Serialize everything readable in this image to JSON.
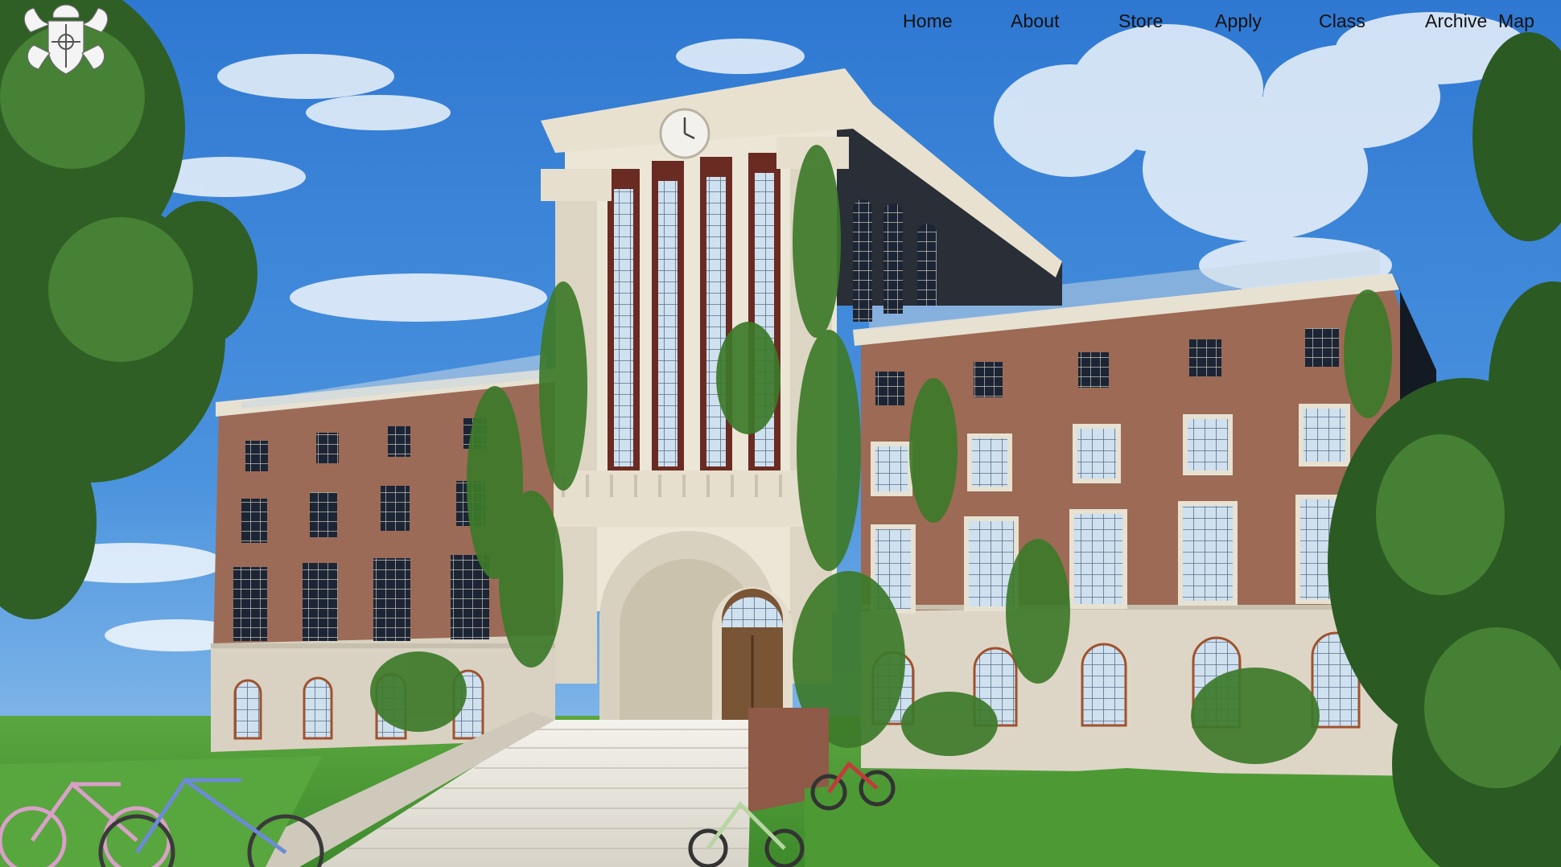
{
  "header": {
    "logo_icon": "crest-logo-icon"
  },
  "nav": {
    "items": [
      {
        "label": "Home"
      },
      {
        "label": "About"
      },
      {
        "label": "Store"
      },
      {
        "label": "Apply"
      },
      {
        "label": "Class"
      },
      {
        "label": "Archive"
      },
      {
        "label": "Map"
      }
    ]
  },
  "colors": {
    "sky": "#3f87d6",
    "brick": "#9b6a55",
    "stone": "#e3dccb",
    "ivy": "#3f7a2a",
    "grass": "#4e9b38",
    "nav_text": "#111111"
  }
}
